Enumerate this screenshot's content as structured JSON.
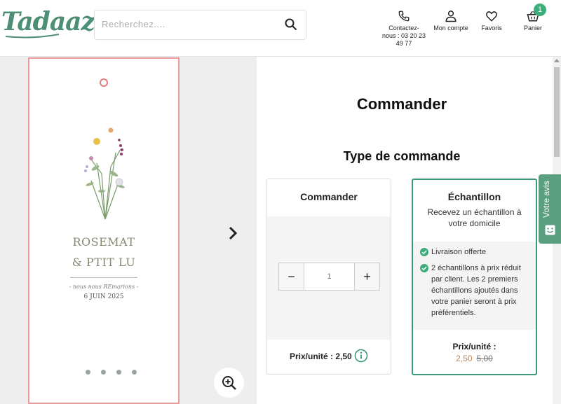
{
  "header": {
    "logo": "Tadaaz",
    "search_placeholder": "Recherchez....",
    "nav": {
      "contact_line1": "Contactez-",
      "contact_line2": "nous : 03 20 23",
      "contact_line3": "49 77",
      "account": "Mon compte",
      "favorites": "Favoris",
      "cart": "Panier",
      "cart_count": "1"
    }
  },
  "card": {
    "name1": "ROSEMAT",
    "name2": "& PTIT LU",
    "subtitle": "- nous nous REmarions -",
    "date": "6 JUIN 2025"
  },
  "main": {
    "title": "Commander",
    "subtitle": "Type de commande"
  },
  "option_order": {
    "title": "Commander",
    "quantity_placeholder": "1",
    "minus_label": "−",
    "plus_label": "+",
    "price_label": "Prix/unité : 2,50"
  },
  "option_sample": {
    "title": "Échantillon",
    "desc_line1": "Recevez un échantillon à",
    "desc_line2": "votre domicile",
    "features": [
      "Livraison offerte",
      "2 échantillons à prix réduit par client. Les 2 premiers échantillons ajoutés dans votre panier seront à prix préférentiels."
    ],
    "price_label": "Prix/unité :",
    "price_new": "2,50",
    "price_old": "5,00"
  },
  "reviews_tab": {
    "label": "Votre avis"
  },
  "colors": {
    "brand_green": "#4c8f74",
    "accent_green": "#3a9a73",
    "card_border": "#e99a9a",
    "price_new": "#b8865a"
  }
}
